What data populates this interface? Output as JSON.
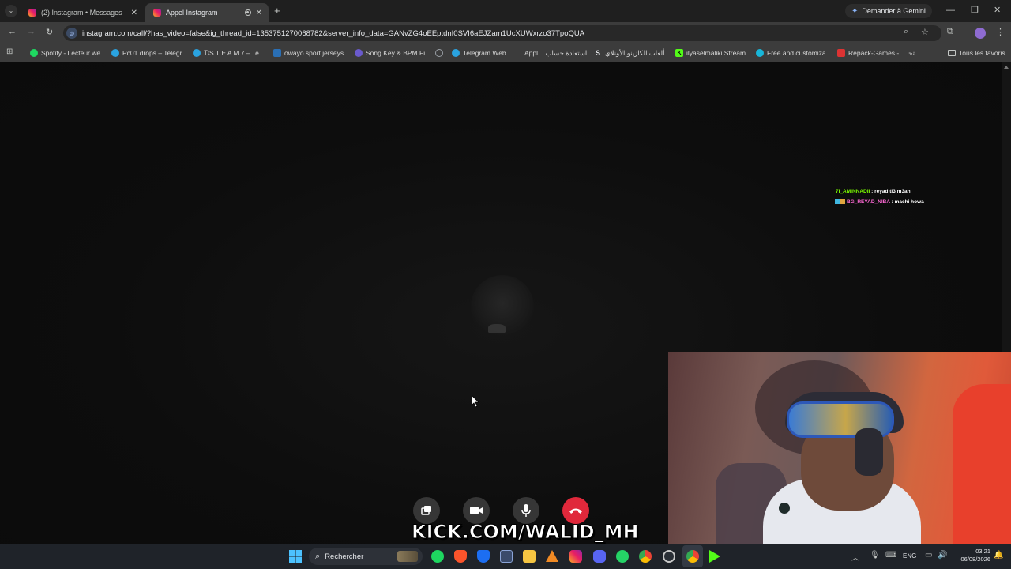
{
  "browser": {
    "tabs": [
      {
        "title": "(2) Instagram • Messages",
        "active": false
      },
      {
        "title": "Appel Instagram",
        "active": true
      }
    ],
    "new_tab_label": "+",
    "gemini_label": "Demander à Gemini",
    "url": "instagram.com/call/?has_video=false&ig_thread_id=1353751270068782&server_info_data=GANvZG4oEEptdnI0SVI6aEJZam1UcXUWxrzo37TpoQUA",
    "bookmarks": [
      {
        "label": "Spotify - Lecteur we...",
        "icon": "spotify-icon",
        "color": "#1ed760"
      },
      {
        "label": "Pc01 drops – Telegr...",
        "icon": "telegram-icon",
        "color": "#2aa3e0"
      },
      {
        "label": "ᗪS T E A M 7 – Te...",
        "icon": "telegram-icon",
        "color": "#2aa3e0"
      },
      {
        "label": "owayo sport jerseys...",
        "icon": "owayo-icon",
        "color": "#2a6fb5"
      },
      {
        "label": "Song Key & BPM Fi...",
        "icon": "song-key-icon",
        "color": "#6a5acd"
      },
      {
        "label": "",
        "icon": "globe-icon",
        "color": "#9aa0a6"
      },
      {
        "label": "Telegram Web",
        "icon": "telegram-icon",
        "color": "#2aa3e0"
      },
      {
        "label": "Appl... استعادة حساب",
        "icon": "apple-icon",
        "color": "#b0b0b0"
      },
      {
        "label": "ألعاب الكازينو الأونلاي...",
        "icon": "casino-icon",
        "color": "#3a3a3a"
      },
      {
        "label": "ilyaselmaliki Stream...",
        "icon": "kick-icon",
        "color": "#53fc18"
      },
      {
        "label": "Free and customiza...",
        "icon": "canva-icon",
        "color": "#18b6d9"
      },
      {
        "label": "Repack-Games - ...تحـ",
        "icon": "repack-icon",
        "color": "#d33"
      }
    ],
    "all_bookmarks_label": "Tous les favoris"
  },
  "chat": [
    {
      "user": "7I_AMINNADII",
      "message": " : reyad tl3 m3ah",
      "color": "#7cfc00"
    },
    {
      "user": "BG_REYAD_NIBA",
      "message": " : machi howa",
      "color": "#ff69d6"
    }
  ],
  "stream": {
    "overlay_text": "KICK.COM/WALID_MH",
    "brand_color": "#53fc18"
  },
  "taskbar": {
    "search_placeholder": "Rechercher",
    "language": "ENG",
    "time": "03:21",
    "date": "06/08/2026"
  }
}
